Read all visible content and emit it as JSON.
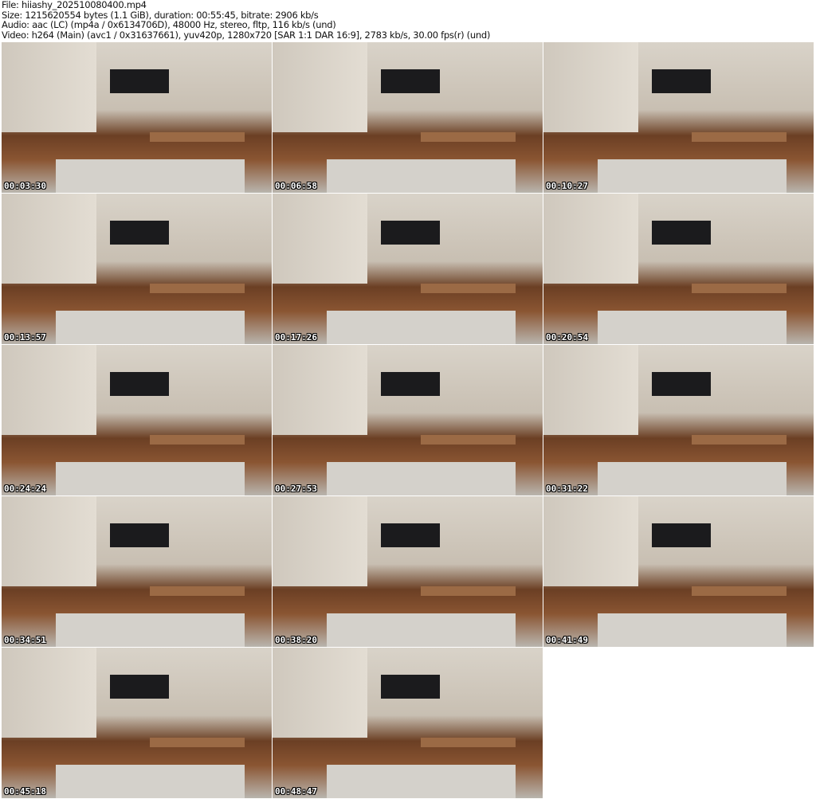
{
  "header": {
    "file": "File: hiiashy_202510080400.mp4",
    "size": "Size: 1215620554 bytes (1.1 GiB), duration: 00:55:45, bitrate: 2906 kb/s",
    "audio": "Audio: aac (LC) (mp4a / 0x6134706D), 48000 Hz, stereo, fltp, 116 kb/s (und)",
    "video": "Video: h264 (Main) (avc1 / 0x31637661), yuv420p, 1280x720 [SAR 1:1 DAR 16:9], 2783 kb/s, 30.00 fps(r) (und)"
  },
  "thumbnails": [
    {
      "time": "00:03:30"
    },
    {
      "time": "00:06:58"
    },
    {
      "time": "00:10:27"
    },
    {
      "time": "00:13:57"
    },
    {
      "time": "00:17:26"
    },
    {
      "time": "00:20:54"
    },
    {
      "time": "00:24:24"
    },
    {
      "time": "00:27:53"
    },
    {
      "time": "00:31:22"
    },
    {
      "time": "00:34:51"
    },
    {
      "time": "00:38:20"
    },
    {
      "time": "00:41:49"
    },
    {
      "time": "00:45:18"
    },
    {
      "time": "00:48:47"
    }
  ]
}
